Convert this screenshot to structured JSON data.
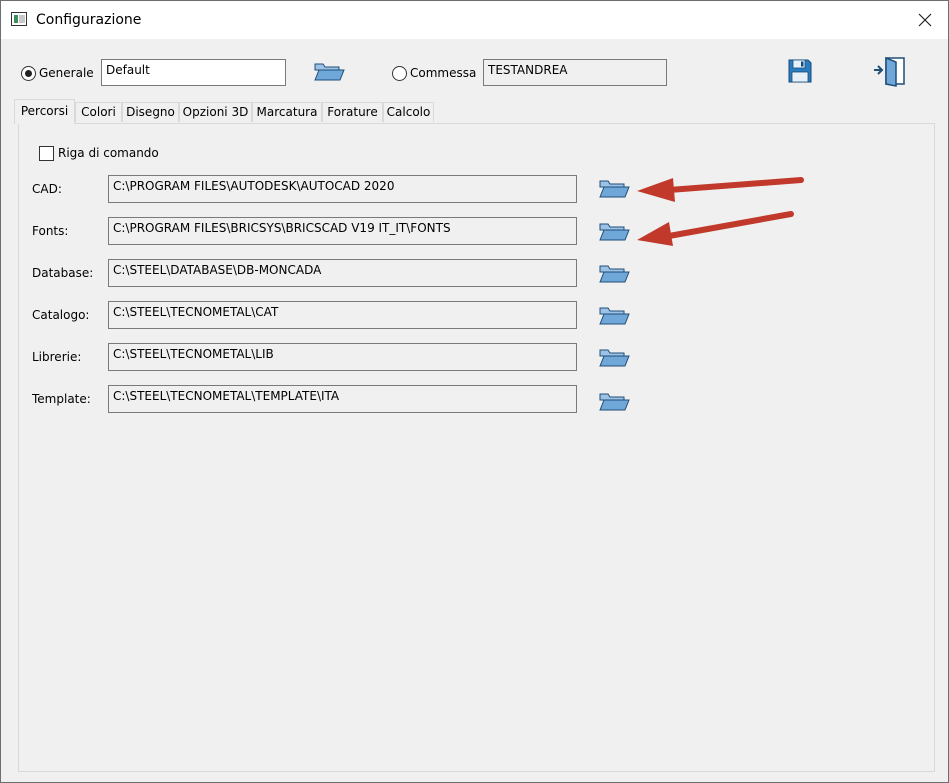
{
  "window": {
    "title": "Configurazione"
  },
  "header": {
    "generale_label": "Generale",
    "generale_value": "Default",
    "commessa_label": "Commessa",
    "commessa_value": "TESTANDREA"
  },
  "tabs": [
    {
      "label": "Percorsi"
    },
    {
      "label": "Colori"
    },
    {
      "label": "Disegno"
    },
    {
      "label": "Opzioni 3D"
    },
    {
      "label": "Marcatura"
    },
    {
      "label": "Forature"
    },
    {
      "label": "Calcolo"
    }
  ],
  "percorsi": {
    "riga_label": "Riga di comando",
    "rows": [
      {
        "label": "CAD:",
        "value": "C:\\PROGRAM FILES\\AUTODESK\\AUTOCAD 2020"
      },
      {
        "label": "Fonts:",
        "value": "C:\\PROGRAM FILES\\BRICSYS\\BRICSCAD V19 IT_IT\\FONTS"
      },
      {
        "label": "Database:",
        "value": "C:\\STEEL\\DATABASE\\DB-MONCADA"
      },
      {
        "label": "Catalogo:",
        "value": "C:\\STEEL\\TECNOMETAL\\CAT"
      },
      {
        "label": "Librerie:",
        "value": "C:\\STEEL\\TECNOMETAL\\LIB"
      },
      {
        "label": "Template:",
        "value": "C:\\STEEL\\TECNOMETAL\\TEMPLATE\\ITA"
      }
    ]
  },
  "icons": [
    "app-icon",
    "close-icon",
    "folder-open-icon",
    "save-icon",
    "exit-icon",
    "annotation-arrow-icon"
  ],
  "colors": {
    "folder": "#6fa7d8",
    "folder_stroke": "#1f4e79",
    "arrow": "#c0392b",
    "save": "#2b7bbf"
  }
}
